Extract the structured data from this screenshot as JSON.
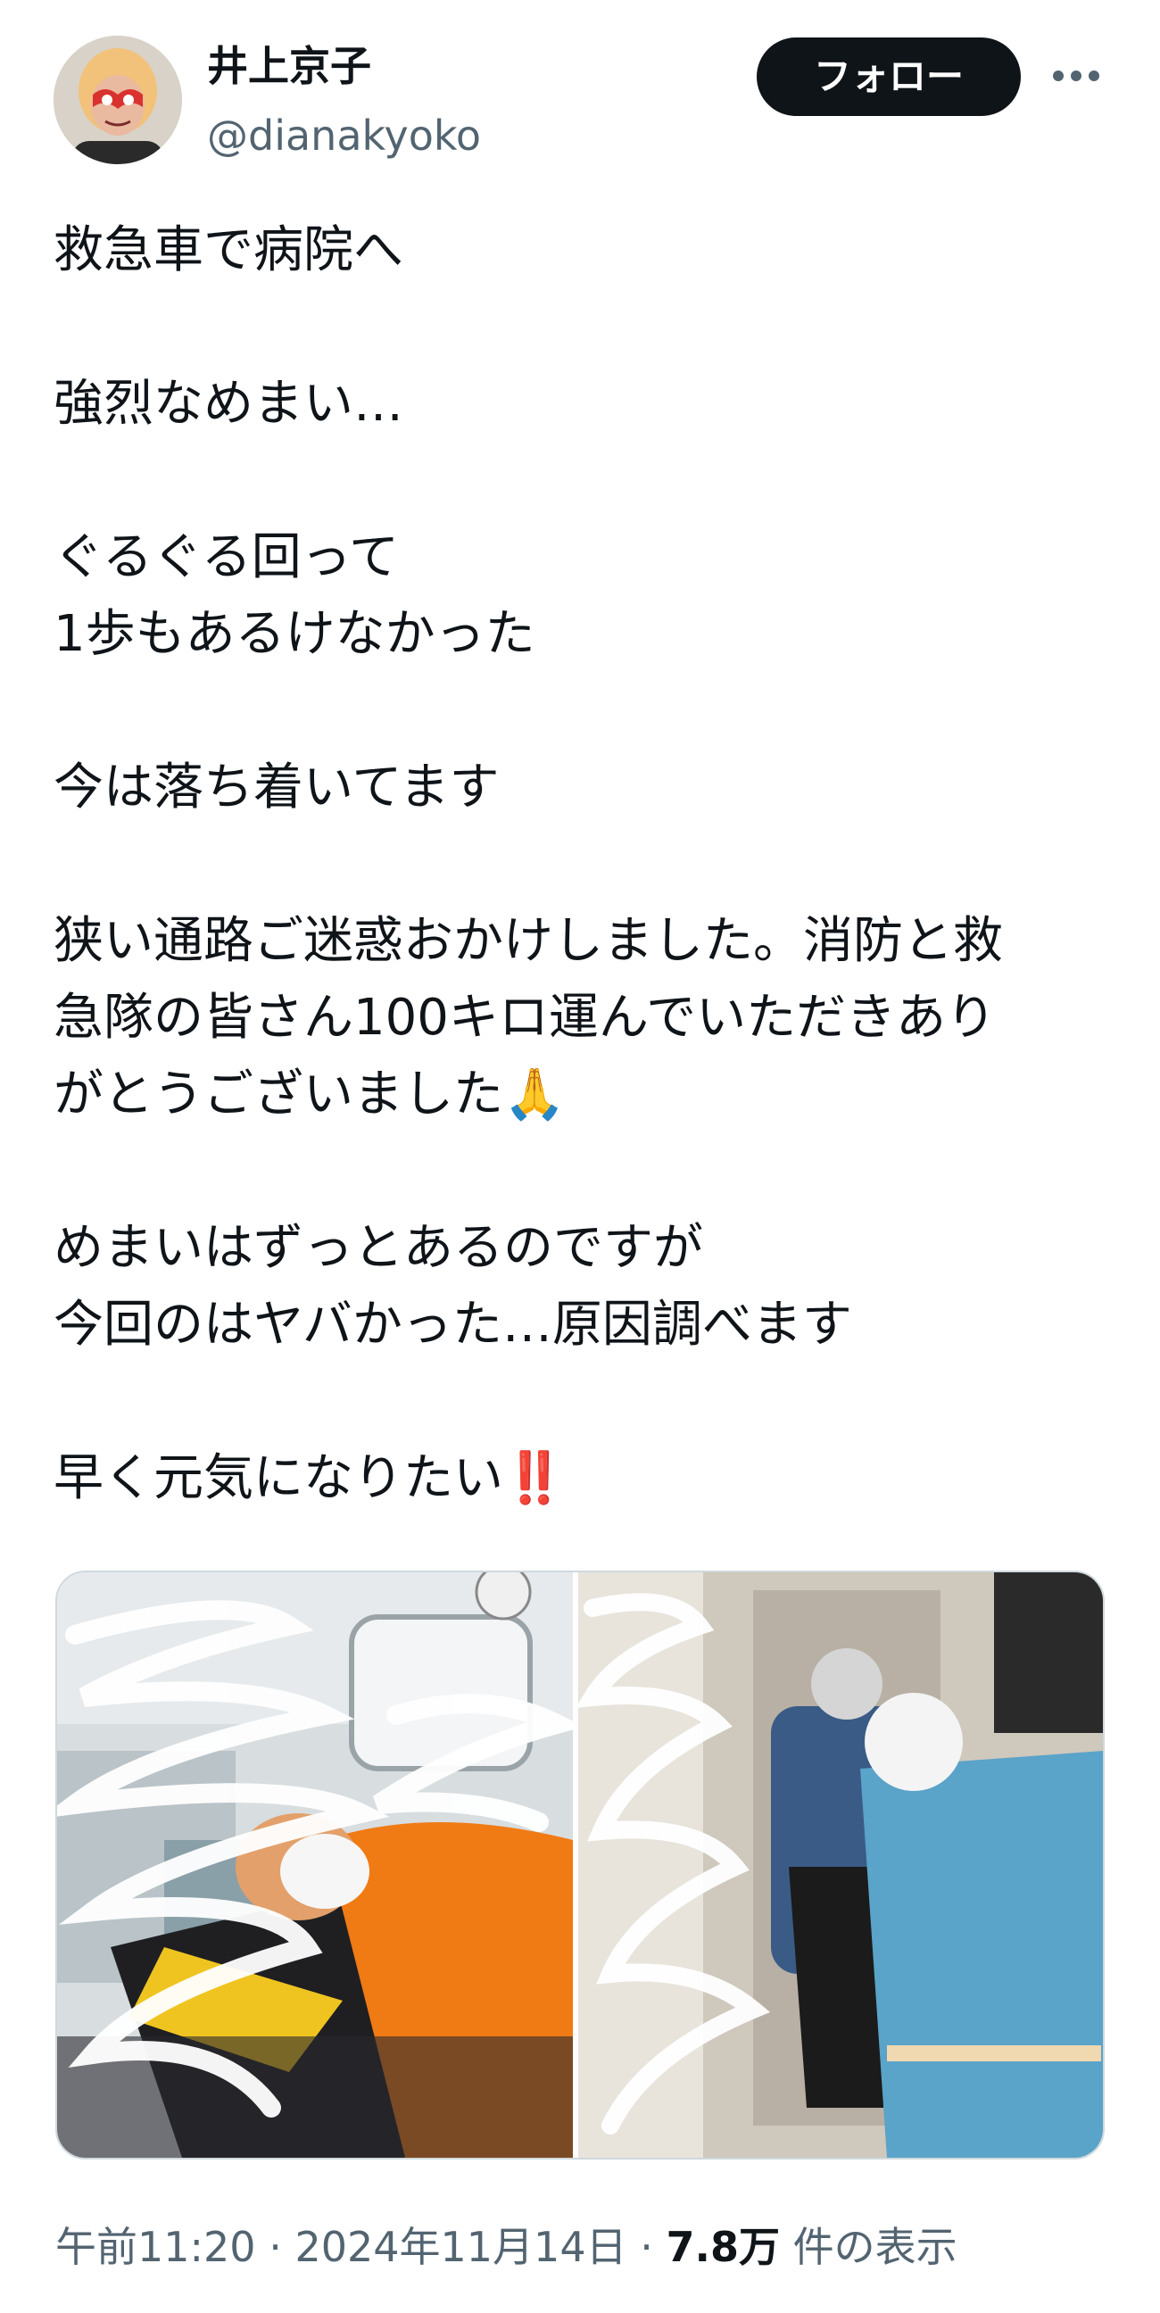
{
  "author": {
    "name": "井上京子",
    "handle": "@dianakyoko"
  },
  "follow_label": "フォロー",
  "more_icon": "more-horizontal-icon",
  "post": {
    "paragraphs": [
      [
        "救急車で病院へ"
      ],
      [
        "強烈なめまい…"
      ],
      [
        "ぐるぐる回って",
        "1歩もあるけなかった"
      ],
      [
        "今は落ち着いてます"
      ],
      [
        "狭い通路ご迷惑おかけしました。消防と救",
        "急隊の皆さん100キロ運んでいただきあり",
        "がとうございました🙏"
      ],
      [
        "めまいはずっとあるのですが",
        "今回のはヤバかった…原因調べます"
      ],
      [
        "早く元気になりたい‼️"
      ]
    ]
  },
  "media": {
    "left_alt": "ambulance-interior-photo",
    "right_alt": "rescue-team-corridor-photo"
  },
  "meta": {
    "time": "午前11:20",
    "date": "2024年11月14日",
    "views_count": "7.8万",
    "views_label": "件の表示",
    "separator": "·"
  }
}
